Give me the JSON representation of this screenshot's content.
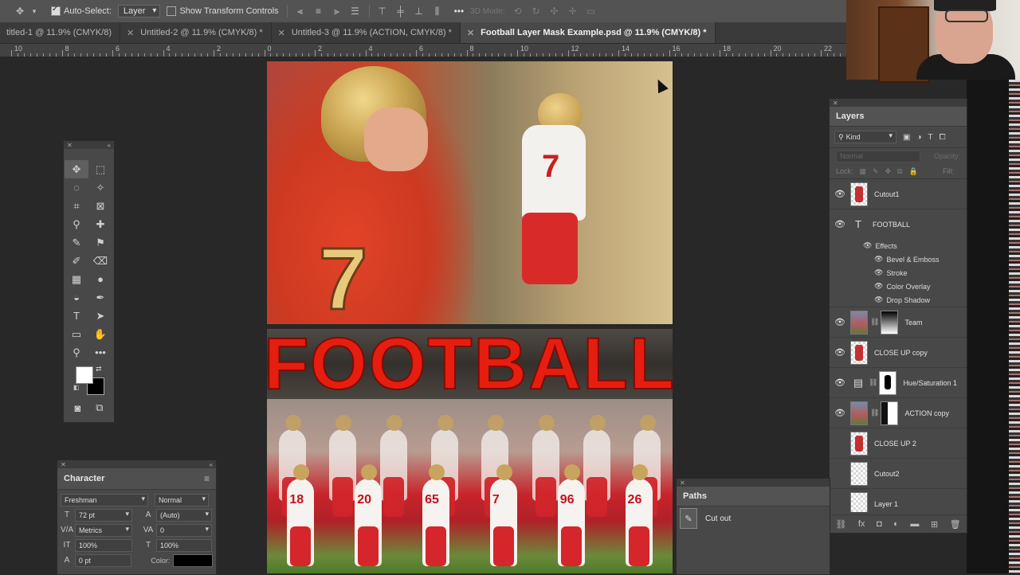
{
  "options_bar": {
    "auto_select_label": "Auto-Select:",
    "auto_select_checked": true,
    "auto_select_target": "Layer",
    "show_transform_label": "Show Transform Controls",
    "mode_3d_label": "3D Mode:",
    "more_label": "•••"
  },
  "tabs": [
    {
      "label": "titled-1 @ 11.9% (CMYK/8)",
      "active": false
    },
    {
      "label": "Untitled-2 @ 11.9% (CMYK/8) *",
      "active": false
    },
    {
      "label": "Untitled-3 @ 11.9% (ACTION, CMYK/8) *",
      "active": false
    },
    {
      "label": "Football Layer Mask Example.psd @ 11.9% (CMYK/8) *",
      "active": true
    }
  ],
  "ruler_labels": [
    "10",
    "8",
    "6",
    "4",
    "2",
    "0",
    "2",
    "4",
    "6",
    "8",
    "10",
    "12",
    "14",
    "16",
    "18",
    "20",
    "22"
  ],
  "poster": {
    "headline": "FOOTBALL",
    "jersey_number": "7",
    "team_numbers": [
      "18",
      "20",
      "65",
      "7",
      "96",
      "26"
    ]
  },
  "character_panel": {
    "title": "Character",
    "font_family": "Freshman",
    "font_style": "Normal",
    "font_size": "72 pt",
    "leading": "(Auto)",
    "kerning": "Metrics",
    "tracking": "0",
    "vertical_scale": "100%",
    "horizontal_scale": "100%",
    "baseline_shift": "0 pt",
    "color_label": "Color:"
  },
  "layers_panel": {
    "title": "Layers",
    "filter_kind": "Kind",
    "blend_mode": "Normal",
    "opacity_label": "Opacity:",
    "lock_label": "Lock:",
    "fill_label": "Fill:",
    "layers": [
      {
        "name": "Cutout1",
        "visible": true,
        "type": "cutout"
      },
      {
        "name": "FOOTBALL",
        "visible": true,
        "type": "text"
      },
      {
        "name": "Team",
        "visible": true,
        "type": "photo-mask-grad"
      },
      {
        "name": "CLOSE UP copy",
        "visible": true,
        "type": "cutout"
      },
      {
        "name": "Hue/Saturation 1",
        "visible": true,
        "type": "adjustment"
      },
      {
        "name": "ACTION copy",
        "visible": true,
        "type": "photo-mask-split"
      },
      {
        "name": "CLOSE UP 2",
        "visible": false,
        "type": "cutout"
      },
      {
        "name": "Cutout2",
        "visible": false,
        "type": "cutout"
      },
      {
        "name": "Layer 1",
        "visible": false,
        "type": "cutout"
      }
    ],
    "effects_label": "Effects",
    "effects": [
      "Bevel & Emboss",
      "Stroke",
      "Color Overlay",
      "Drop Shadow"
    ]
  },
  "paths_panel": {
    "title": "Paths",
    "paths": [
      "Cut out"
    ]
  },
  "colors": {
    "panel_bg": "#484848",
    "headline_red": "#e51e10",
    "foreground_swatch": "#ffffff",
    "background_swatch": "#000000"
  }
}
